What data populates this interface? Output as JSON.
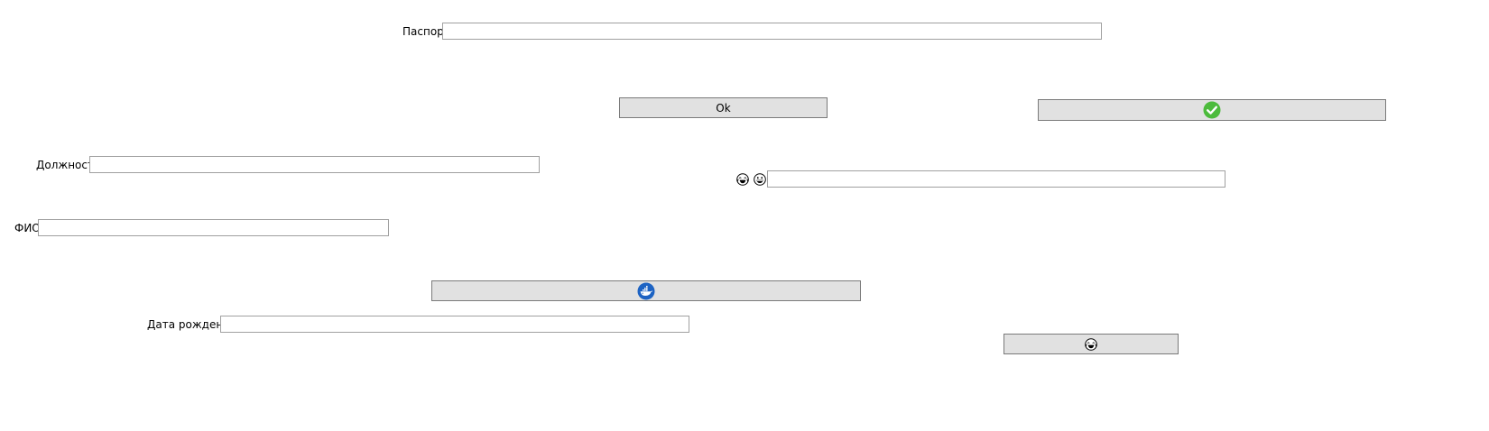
{
  "passport": {
    "label": "Паспорт",
    "value": ""
  },
  "ok_button": {
    "label": "Ok"
  },
  "check_button": {
    "icon": "check-circle-icon",
    "icon_color": "#4cbb3c"
  },
  "position": {
    "label": "Должность",
    "value": ""
  },
  "emoji_field": {
    "icons": [
      "laughing-emoji-icon",
      "grinning-emoji-icon"
    ],
    "value": ""
  },
  "fio": {
    "label": "ФИО",
    "value": ""
  },
  "docker_button": {
    "icon": "docker-whale-icon",
    "icon_color": "#1d63c3"
  },
  "birth_date": {
    "label": "Дата рождения",
    "value": ""
  },
  "emoji_button": {
    "icon": "laughing-emoji-icon"
  },
  "colors": {
    "button_bg": "#e1e1e1",
    "button_border": "#7a7a7a",
    "field_border": "#a0a0a0"
  }
}
